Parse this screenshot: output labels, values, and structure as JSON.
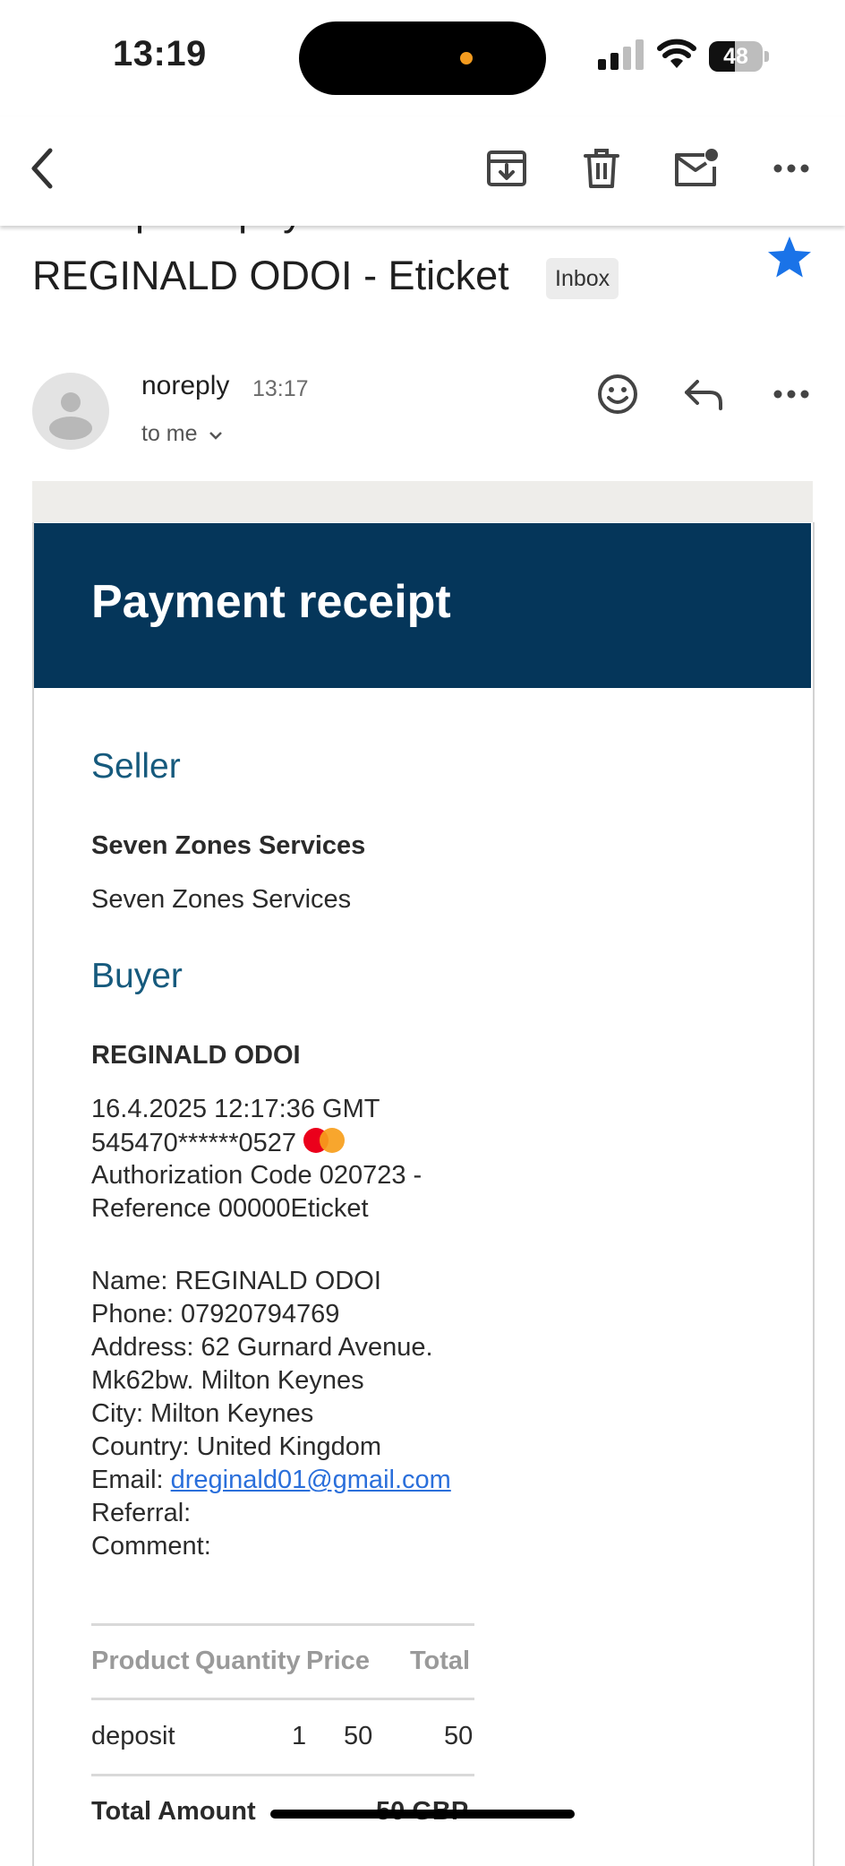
{
  "status_bar": {
    "time": "13:19",
    "battery": "48",
    "battery_level": 0.48
  },
  "toolbar": {
    "back": "back-icon",
    "archive": "archive-icon",
    "delete": "trash-icon",
    "mark_unread": "mail-unread-icon",
    "more": "more-icon"
  },
  "email": {
    "subject_line1": "Receipt for payment from",
    "subject_line2": "REGINALD ODOI - Eticket",
    "label": "Inbox",
    "starred": true,
    "sender": "noreply",
    "time": "13:17",
    "recipient": "to me",
    "colors": {
      "accent_star": "#1a73e8"
    }
  },
  "receipt": {
    "title": "Payment receipt",
    "seller_heading": "Seller",
    "seller_name_bold": "Seven Zones Services",
    "seller_name": "Seven Zones Services",
    "buyer_heading": "Buyer",
    "buyer_name": "REGINALD ODOI",
    "datetime": "16.4.2025 12:17:36 GMT",
    "card_number": "545470******0527",
    "auth_line": "Authorization Code 020723 -",
    "reference_line": "Reference 00000Eticket",
    "name_line": "Name: REGINALD ODOI",
    "phone_line": "Phone: 07920794769",
    "address_line1": "Address: 62 Gurnard Avenue.",
    "address_line2": "Mk62bw. Milton Keynes",
    "city_line": "City: Milton Keynes",
    "country_line": "Country: United Kingdom",
    "email_label": "Email: ",
    "email_value": "dreginald01@gmail.com",
    "referral_line": "Referral:",
    "comment_line": "Comment:",
    "table": {
      "headers": [
        "Product",
        "Quantity",
        "Price",
        "Total"
      ],
      "rows": [
        {
          "product": "deposit",
          "quantity": "1",
          "price": "50",
          "total": "50"
        }
      ]
    },
    "total_label": "Total Amount",
    "total_value": "50 GBP",
    "colors": {
      "banner": "#05365a",
      "heading": "#165a7d",
      "link": "#2a6fdb"
    }
  }
}
